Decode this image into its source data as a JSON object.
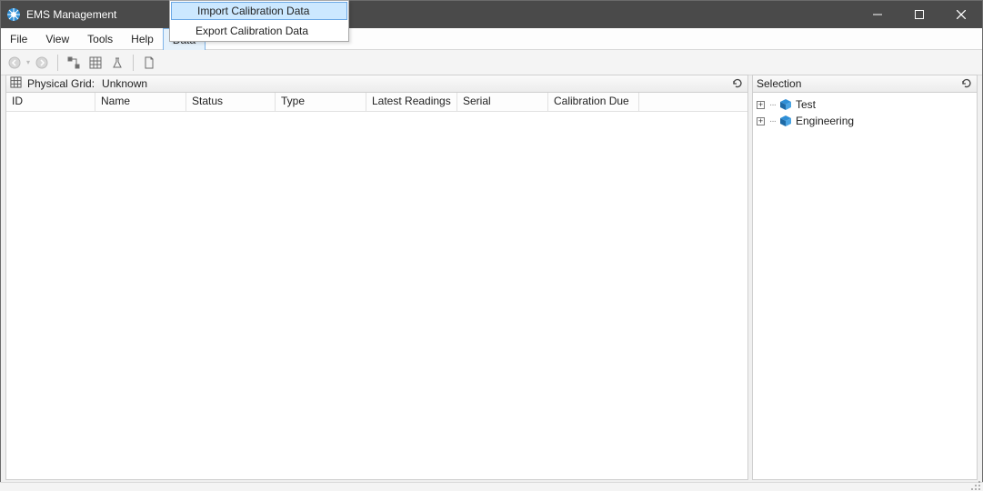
{
  "window": {
    "title": "EMS Management"
  },
  "menubar": {
    "file": "File",
    "view": "View",
    "tools": "Tools",
    "help": "Help",
    "data": "Data"
  },
  "data_menu": {
    "import": "Import Calibration Data",
    "export": "Export Calibration Data"
  },
  "left_panel": {
    "label_prefix": "Physical Grid:",
    "grid_name": "Unknown",
    "columns": {
      "id": "ID",
      "name": "Name",
      "status": "Status",
      "type": "Type",
      "latest": "Latest Readings",
      "serial": "Serial",
      "caldue": "Calibration Due"
    }
  },
  "right_panel": {
    "title": "Selection",
    "tree": {
      "item0": "Test",
      "item1": "Engineering"
    }
  }
}
